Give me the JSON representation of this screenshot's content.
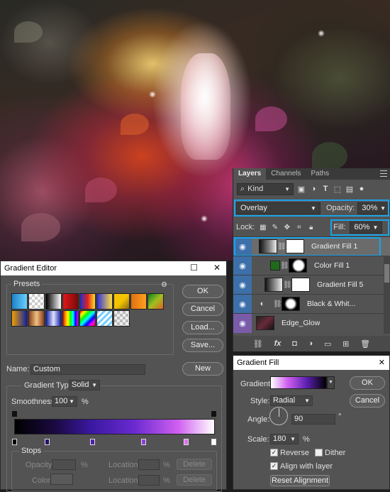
{
  "layers_panel": {
    "tabs": [
      "Layers",
      "Channels",
      "Paths"
    ],
    "filter_kind": "Kind",
    "blend_mode": "Overlay",
    "opacity_label": "Opacity:",
    "opacity_value": "30%",
    "lock_label": "Lock:",
    "fill_label": "Fill:",
    "fill_value": "60%",
    "layers": [
      {
        "name": "Gradient Fill 1",
        "selected": true
      },
      {
        "name": "Color Fill 1",
        "selected": false
      },
      {
        "name": "Gradient Fill 5",
        "selected": false
      },
      {
        "name": "Black & Whit...",
        "selected": false
      },
      {
        "name": "Edge_Glow",
        "selected": false
      }
    ],
    "highlight_color": "#1aa3e8"
  },
  "gradient_editor": {
    "title": "Gradient Editor",
    "presets_label": "Presets",
    "buttons": {
      "ok": "OK",
      "cancel": "Cancel",
      "load": "Load...",
      "save": "Save...",
      "new": "New"
    },
    "name_label": "Name:",
    "name_value": "Custom",
    "gradient_type_label": "Gradient Type:",
    "gradient_type_value": "Solid",
    "smoothness_label": "Smoothness:",
    "smoothness_value": "100",
    "smoothness_unit": "%",
    "stops_label": "Stops",
    "opacity_label": "Opacity:",
    "color_label": "Color:",
    "location_label": "Location:",
    "percent": "%",
    "delete_label": "Delete"
  },
  "gradient_fill": {
    "title": "Gradient Fill",
    "gradient_label": "Gradient:",
    "style_label": "Style:",
    "style_value": "Radial",
    "angle_label": "Angle:",
    "angle_value": "90",
    "angle_unit": "°",
    "scale_label": "Scale:",
    "scale_value": "180",
    "scale_unit": "%",
    "reverse_label": "Reverse",
    "reverse_checked": true,
    "dither_label": "Dither",
    "dither_checked": false,
    "align_label": "Align with layer",
    "align_checked": true,
    "reset_label": "Reset Alignment",
    "ok_label": "OK",
    "cancel_label": "Cancel"
  }
}
